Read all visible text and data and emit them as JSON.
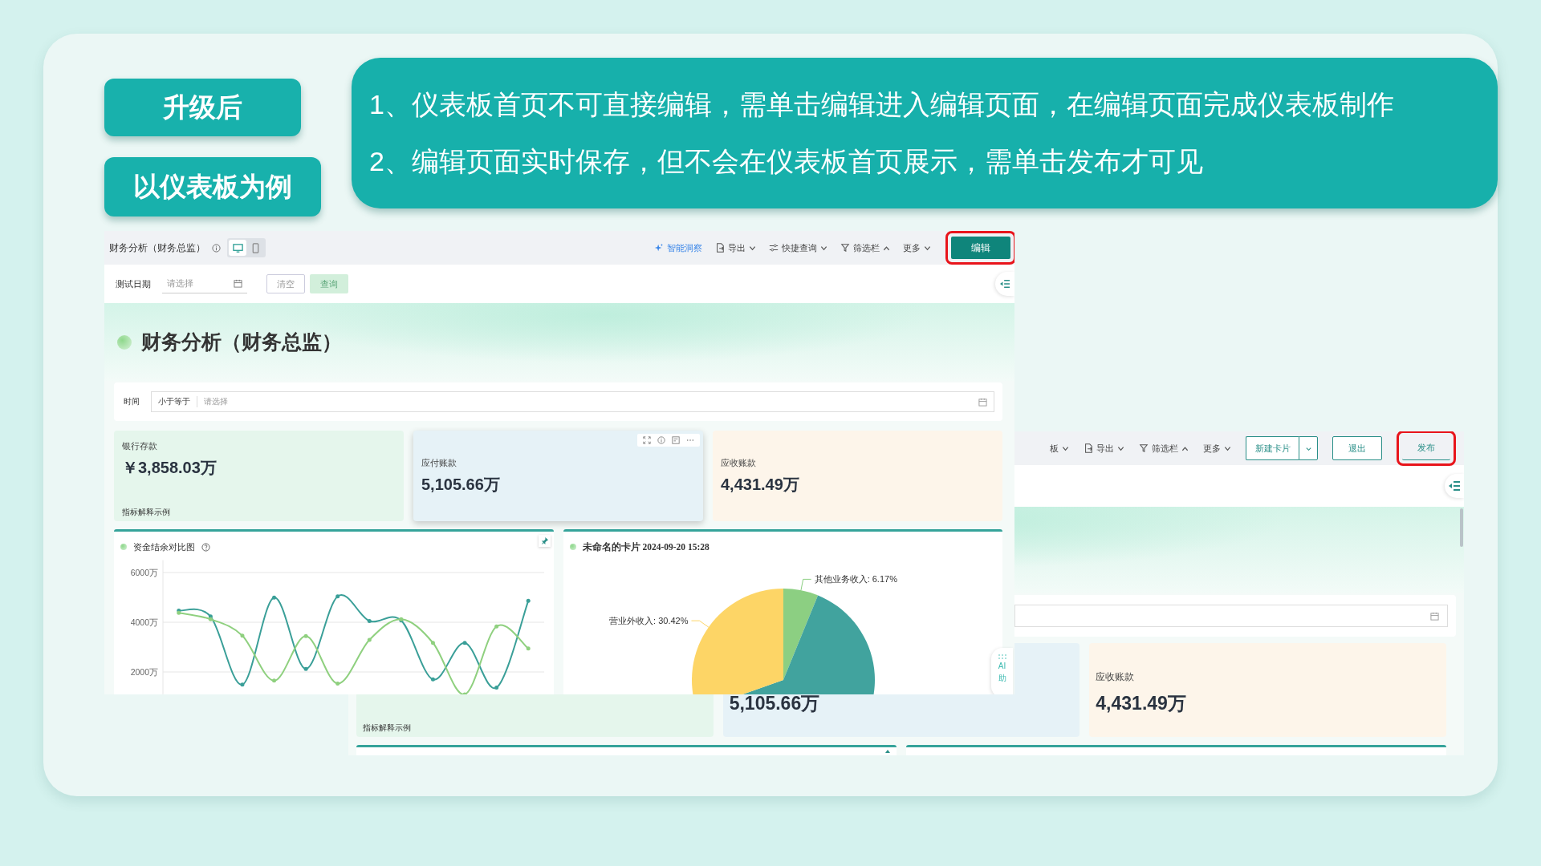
{
  "slide": {
    "tags": [
      "升级后",
      "以仪表板为例"
    ],
    "notes": [
      "1、仪表板首页不可直接编辑，需单击编辑进入编辑页面，在编辑页面完成仪表板制作",
      "2、编辑页面实时保存，但不会在仪表板首页展示，需单击发布才可见"
    ]
  },
  "home_screen": {
    "toolbar": {
      "title": "财务分析（财务总监）",
      "device_toggle": [
        {
          "kind": "desktop",
          "selected": true
        },
        {
          "kind": "mobile",
          "selected": false
        }
      ],
      "actions": [
        {
          "kind": "ai",
          "label": "智能洞察"
        },
        {
          "kind": "export",
          "label": "导出",
          "expanded": false
        },
        {
          "kind": "query",
          "label": "快捷查询",
          "expanded": false
        },
        {
          "kind": "filter",
          "label": "筛选栏",
          "expanded": true
        },
        {
          "kind": "more",
          "label": "更多",
          "expanded": false
        }
      ],
      "edit_button": {
        "label": "编辑",
        "highlighted": true
      }
    },
    "filter_row": {
      "label": "测试日期",
      "placeholder": "请选择",
      "buttons": [
        {
          "label": "清空",
          "disabled": false
        },
        {
          "label": "查询",
          "disabled": true
        }
      ]
    },
    "dashboard_title": "财务分析（财务总监）",
    "time_filter": {
      "label": "时间",
      "operator": "小于等于",
      "placeholder": "请选择"
    },
    "kpi_cards": [
      {
        "color": "#e5f6ec",
        "label": "银行存款",
        "value": "￥3,858.03万",
        "note": "指标解释示例",
        "hovered": false
      },
      {
        "color": "#e6f2f7",
        "label": "应付账款",
        "value": "5,105.66万",
        "hovered": true
      },
      {
        "color": "#fdf5ea",
        "label": "应收账款",
        "value": "4,431.49万",
        "hovered": false
      }
    ],
    "line_card": {
      "title": "资金结余对比图",
      "chart_data": {
        "type": "line",
        "grid": true,
        "ylim": [
          1100,
          6500
        ],
        "yticks": [
          {
            "value": 2000,
            "label": "2000万"
          },
          {
            "value": 4000,
            "label": "4000万"
          },
          {
            "value": 6000,
            "label": "6000万"
          }
        ],
        "series": [
          {
            "color": "#3a9f98",
            "values": [
              4470,
              4230,
              1490,
              4990,
              2120,
              5040,
              4050,
              4070,
              1700,
              3170,
              1370,
              4860
            ]
          },
          {
            "color": "#8fd07f",
            "values": [
              4380,
              4120,
              3460,
              1650,
              3440,
              1530,
              3290,
              4120,
              3170,
              1100,
              3830,
              2940
            ]
          }
        ]
      }
    },
    "pie_card": {
      "title": "未命名的卡片 2024-09-20 15:28",
      "chart_data": {
        "type": "pie",
        "values": [
          6.17,
          63.41,
          30.42
        ],
        "value_labels": [
          "其他业务收入: 6.17%",
          null,
          "营业外收入: 30.42%"
        ]
      }
    },
    "ai_widget": [
      "AI",
      "助"
    ]
  },
  "edit_screen": {
    "toolbar": {
      "actions": [
        {
          "kind": "template",
          "label": "板",
          "expanded": false
        },
        {
          "kind": "export",
          "label": "导出",
          "expanded": false
        },
        {
          "kind": "filter",
          "label": "筛选栏",
          "expanded": true
        },
        {
          "kind": "more",
          "label": "更多",
          "expanded": false
        }
      ],
      "new_card_button": "新建卡片",
      "exit_button": "退出",
      "publish_button": {
        "label": "发布",
        "highlighted": true
      }
    },
    "kpi_cards": [
      {
        "color": "#e5f6ec",
        "note": "指标解释示例"
      },
      {
        "color": "#e6f2f7",
        "value": "5,105.66万"
      },
      {
        "color": "#fdf5ea",
        "label": "应收账款",
        "value": "4,431.49万"
      }
    ]
  }
}
